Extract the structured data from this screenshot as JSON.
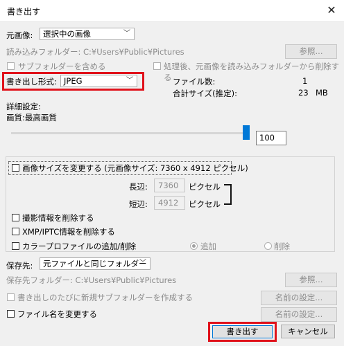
{
  "window": {
    "title": "書き出す",
    "close_glyph": "✕"
  },
  "source": {
    "label": "元画像:",
    "selected": "選択中の画像"
  },
  "read_folder": {
    "text": "読み込みフォルダー: C:¥Users¥Public¥Pictures",
    "browse_label": "参照..."
  },
  "subfolder_checkbox": {
    "label": "サブフォルダーを含める",
    "checked": false
  },
  "delete_after_checkbox": {
    "label": "処理後、元画像を読み込みフォルダーから削除する",
    "checked": false
  },
  "format": {
    "label": "書き出し形式:",
    "selected": "JPEG"
  },
  "stats": {
    "file_count_label": "ファイル数:",
    "file_count_value": "1",
    "total_size_label": "合計サイズ(推定):",
    "total_size_value": "23",
    "total_size_unit": "MB"
  },
  "detail": {
    "label": "詳細設定:",
    "quality_label": "画質:最高画質",
    "quality_value": "100",
    "slider_fraction": 1.0
  },
  "resize": {
    "checkbox_label": "画像サイズを変更する (元画像サイズ: 7360 x 4912 ピクセル)",
    "checked": false,
    "long_label": "長辺:",
    "long_value": "7360",
    "long_unit": "ピクセル",
    "short_label": "短辺:",
    "short_value": "4912",
    "short_unit": "ピクセル"
  },
  "remove_exif": {
    "label": "撮影情報を削除する",
    "checked": false
  },
  "remove_xmp": {
    "label": "XMP/IPTC情報を削除する",
    "checked": false
  },
  "profile": {
    "label": "カラープロファイルの追加/削除",
    "checked": false,
    "add_label": "追加",
    "remove_label": "削除",
    "selected": "追加"
  },
  "save_to": {
    "label": "保存先:",
    "selected": "元ファイルと同じフォルダー"
  },
  "save_folder": {
    "text": "保存先フォルダー: C:¥Users¥Public¥Pictures",
    "browse_label": "参照..."
  },
  "new_subfolder": {
    "label": "書き出しのたびに新規サブフォルダーを作成する",
    "checked": false,
    "naming_label": "名前の設定..."
  },
  "rename": {
    "label": "ファイル名を変更する",
    "checked": false,
    "naming_label": "名前の設定..."
  },
  "actions": {
    "export_label": "書き出す",
    "cancel_label": "キャンセル"
  },
  "colors": {
    "highlight": "#e0121b",
    "slider_accent": "#0078d7"
  }
}
